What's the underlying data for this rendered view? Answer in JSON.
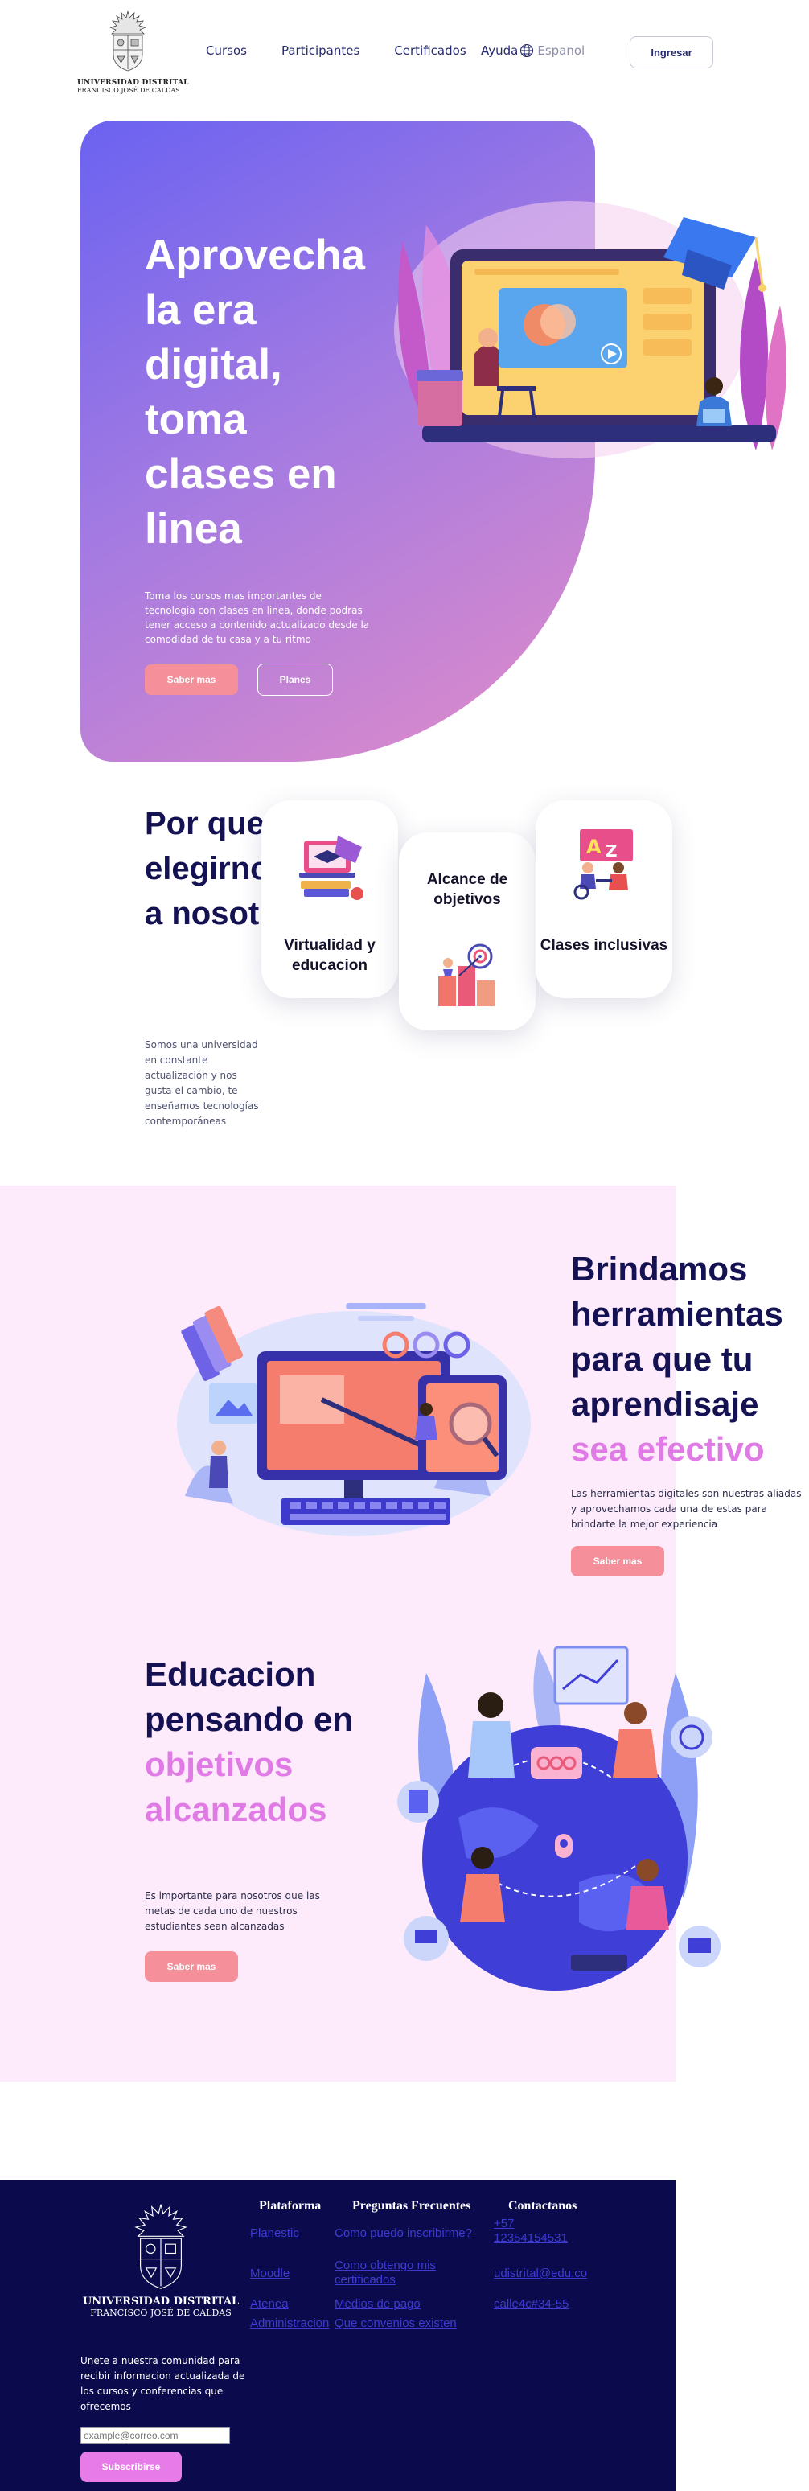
{
  "header": {
    "logo_name": "UNIVERSIDAD DISTRITAL",
    "logo_sub": "FRANCISCO JOSÉ DE CALDAS",
    "nav": [
      "Cursos",
      "Participantes",
      "Certificados",
      "Ayuda"
    ],
    "language": "Espanol",
    "login_label": "Ingresar"
  },
  "hero": {
    "title": "Aprovecha la era digital, toma clases en linea",
    "text": "Toma los cursos mas importantes de tecnologia con clases en linea, donde podras tener acceso a contenido actualizado desde la comodidad de tu casa y a tu ritmo",
    "primary_label": "Saber mas",
    "secondary_label": "Planes"
  },
  "why": {
    "title": "Por que elegirnos a nosotros",
    "text": "Somos una universidad en constante actualización y nos gusta el cambio, te enseñamos tecnologías contemporáneas",
    "cards": [
      "Virtualidad y educacion",
      "Alcance de objetivos",
      "Clases inclusivas"
    ]
  },
  "tools": {
    "title": "Brindamos herramientas para que tu aprendisaje",
    "title_accent": "sea efectivo",
    "text": "Las herramientas digitales son nuestras aliadas y aprovechamos cada una de estas para brindarte la mejor experiencia",
    "button_label": "Saber mas"
  },
  "edu": {
    "title": "Educacion pensando en",
    "title_accent": "objetivos alcanzados",
    "text": "Es importante para nosotros que las metas de cada uno de nuestros estudiantes sean alcanzadas",
    "button_label": "Saber mas"
  },
  "footer": {
    "logo_name": "UNIVERSIDAD DISTRITAL",
    "logo_sub": "FRANCISCO JOSÉ DE CALDAS",
    "newsletter_text": "Unete a nuestra comunidad para recibir informacion actualizada de los cursos y conferencias que ofrecemos",
    "email_placeholder": "example@correo.com",
    "subscribe_label": "Subscribirse",
    "columns": {
      "plataforma": {
        "title": "Plataforma",
        "links": [
          "Planestic",
          "Moodle",
          "Atenea",
          "Administracion"
        ]
      },
      "faq": {
        "title": "Preguntas Frecuentes",
        "links": [
          "Como puedo inscribirme?",
          "Como obtengo mis certificados",
          "Medios de pago",
          "Que convenios existen"
        ]
      },
      "contact": {
        "title": "Contactanos",
        "links": [
          "+57 12354154531",
          "udistrital@edu.co",
          "calle4c#34-55"
        ]
      }
    }
  },
  "colors": {
    "hero_start": "#6a62f1",
    "hero_end": "#e28cc8",
    "navy": "#141252",
    "pink_button": "#f5909b",
    "accent_text": "#e07be6",
    "panel": "#fdeafb",
    "footer_bg": "#0a0a4d",
    "link": "#3d3bd1"
  },
  "icons": [
    "university-seal-icon",
    "globe-icon"
  ]
}
